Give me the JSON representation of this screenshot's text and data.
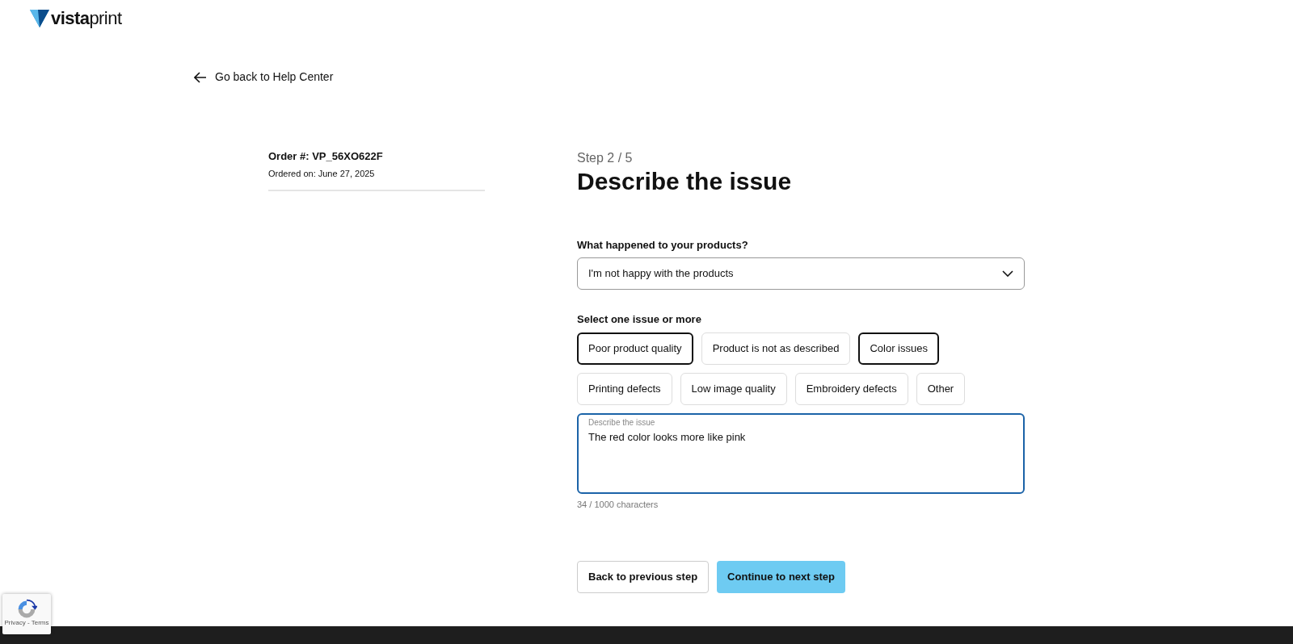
{
  "logo": {
    "text": "**vista**print"
  },
  "back_link": "Go back to Help Center",
  "order": {
    "number": "Order #: VP_56XO622F",
    "date": "Ordered on: June 27, 2025"
  },
  "step": "Step 2 / 5",
  "title": "Describe the issue",
  "question": {
    "label": "What happened to your products?",
    "value": "I'm not happy with the products"
  },
  "issues_label": "Select one issue or more",
  "issues": [
    {
      "label": "Poor product quality",
      "selected": true
    },
    {
      "label": "Product is not as described",
      "selected": false
    },
    {
      "label": "Color issues",
      "selected": true
    },
    {
      "label": "Printing defects",
      "selected": false
    },
    {
      "label": "Low image quality",
      "selected": false
    },
    {
      "label": "Embroidery defects",
      "selected": false
    },
    {
      "label": "Other",
      "selected": false
    }
  ],
  "description": {
    "label": "Describe the issue",
    "value": "The red color looks more like pink",
    "counter": "34 / 1000 characters"
  },
  "buttons": [
    {
      "label": "Back to previous step",
      "kind": "secondary"
    },
    {
      "label": "Continue to next step",
      "kind": "primary"
    }
  ],
  "recaptcha": {
    "links": "Privacy - Terms"
  }
}
